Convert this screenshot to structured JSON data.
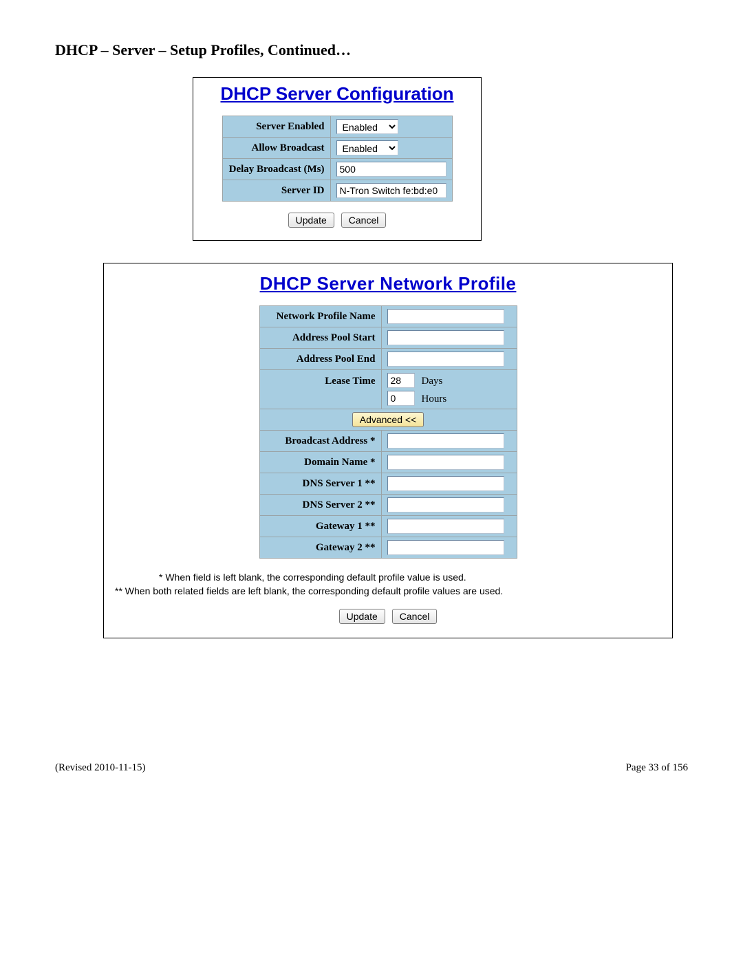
{
  "heading": "DHCP – Server – Setup Profiles, Continued…",
  "config": {
    "title": "DHCP Server Configuration",
    "rows": {
      "server_enabled_label": "Server Enabled",
      "server_enabled_value": "Enabled",
      "allow_broadcast_label": "Allow Broadcast",
      "allow_broadcast_value": "Enabled",
      "delay_broadcast_label": "Delay Broadcast (Ms)",
      "delay_broadcast_value": "500",
      "server_id_label": "Server ID",
      "server_id_value": "N-Tron Switch fe:bd:e0"
    },
    "buttons": {
      "update": "Update",
      "cancel": "Cancel"
    }
  },
  "profile": {
    "title": "DHCP Server Network Profile",
    "rows": {
      "name_label": "Network Profile Name",
      "name_value": "",
      "pool_start_label": "Address Pool Start",
      "pool_start_value": "",
      "pool_end_label": "Address Pool End",
      "pool_end_value": "",
      "lease_time_label": "Lease Time",
      "lease_days_value": "28",
      "lease_days_unit": "Days",
      "lease_hours_value": "0",
      "lease_hours_unit": "Hours",
      "advanced_label": "Advanced <<",
      "broadcast_label": "Broadcast Address *",
      "broadcast_value": "",
      "domain_label": "Domain Name *",
      "domain_value": "",
      "dns1_label": "DNS Server 1 **",
      "dns1_value": "",
      "dns2_label": "DNS Server 2 **",
      "dns2_value": "",
      "gw1_label": "Gateway 1 **",
      "gw1_value": "",
      "gw2_label": "Gateway 2 **",
      "gw2_value": ""
    },
    "notes": {
      "line1": "* When field is left blank, the corresponding default profile value is used.",
      "line2": "** When both related fields are left blank, the corresponding default profile values are used."
    },
    "buttons": {
      "update": "Update",
      "cancel": "Cancel"
    }
  },
  "footer": {
    "left": "(Revised 2010-11-15)",
    "right": "Page 33 of 156"
  }
}
